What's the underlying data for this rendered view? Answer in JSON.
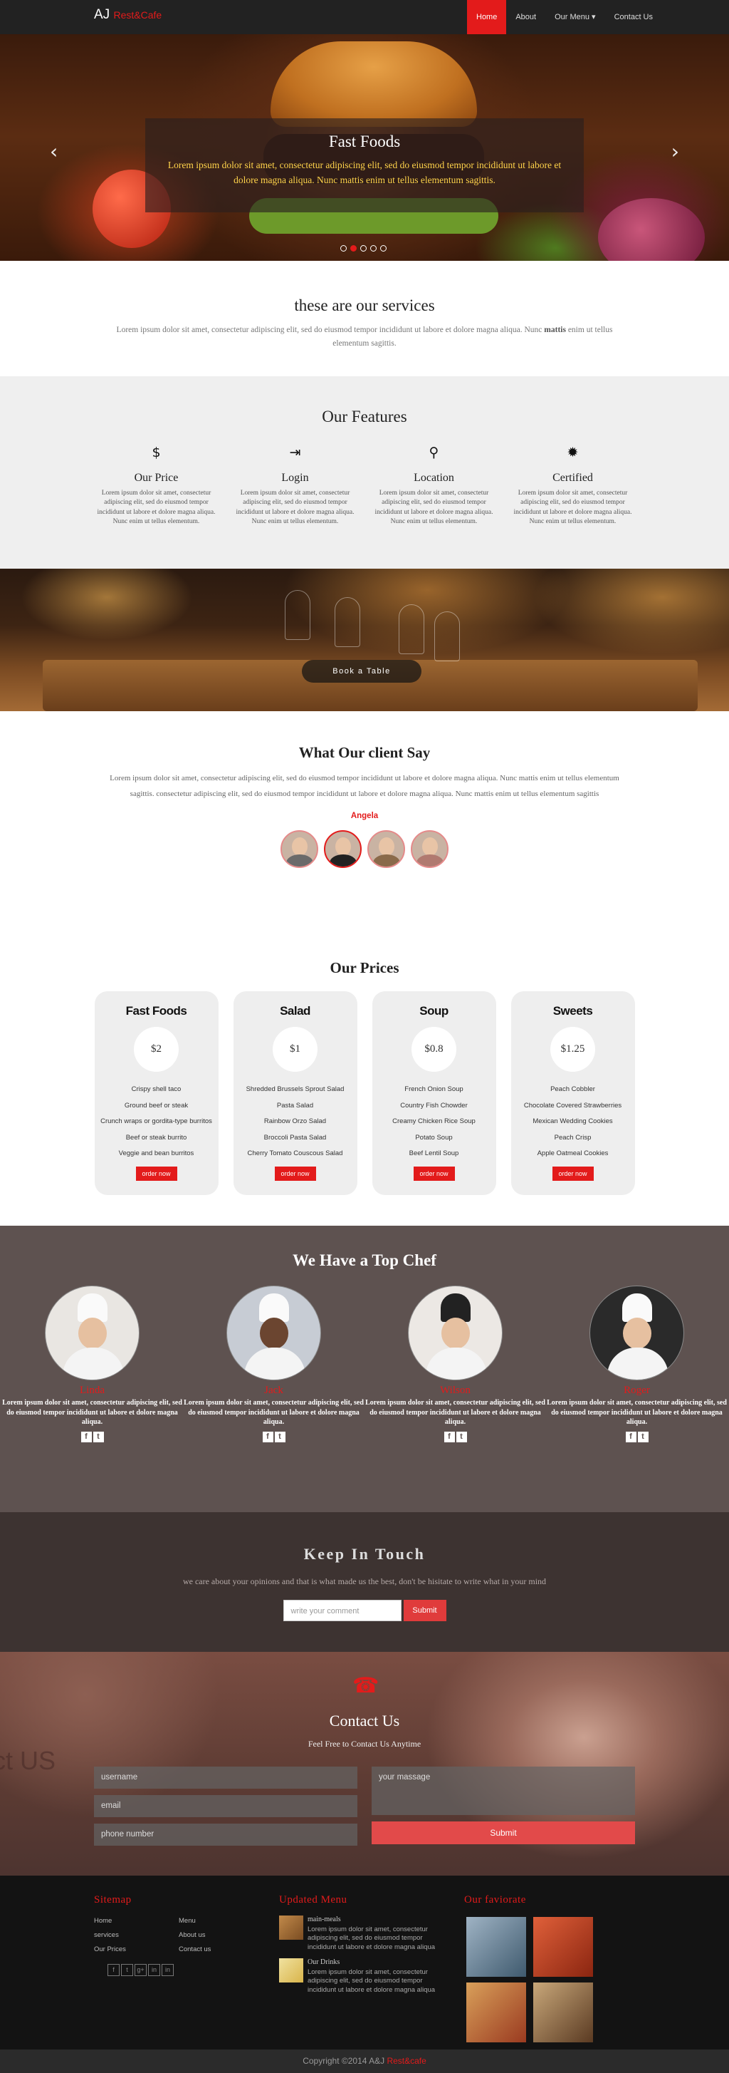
{
  "navbar": {
    "brand_main": "AJ",
    "brand_accent": "Rest&Cafe",
    "items": [
      {
        "label": "Home",
        "active": true
      },
      {
        "label": "About"
      },
      {
        "label": "Our Menu ▾"
      },
      {
        "label": "Contact Us"
      }
    ]
  },
  "hero": {
    "title": "Fast Foods",
    "text": "Lorem ipsum dolor sit amet, consectetur adipiscing elit, sed do eiusmod tempor incididunt ut labore et dolore magna aliqua. Nunc mattis enim ut tellus elementum sagittis.",
    "prev_icon": "chevron-left-icon",
    "next_icon": "chevron-right-icon",
    "slide_count": 5,
    "active_slide": 1
  },
  "services": {
    "title": "these are our services",
    "text": "Lorem ipsum dolor sit amet, consectetur adipiscing elit, sed do eiusmod tempor incididunt ut labore et dolore magna aliqua. Nunc",
    "bold": "mattis",
    "text2": "enim ut tellus elementum sagittis."
  },
  "features": {
    "title": "Our Features",
    "items": [
      {
        "icon": "dollar-icon",
        "glyph": "$",
        "title": "Our Price",
        "text": "Lorem ipsum dolor sit amet, consectetur adipiscing elit, sed do eiusmod tempor incididunt ut labore et dolore magna aliqua. Nunc enim ut tellus elementum."
      },
      {
        "icon": "login-icon",
        "glyph": "⇥",
        "title": "Login",
        "text": "Lorem ipsum dolor sit amet, consectetur adipiscing elit, sed do eiusmod tempor incididunt ut labore et dolore magna aliqua. Nunc enim ut tellus elementum."
      },
      {
        "icon": "map-marker-icon",
        "glyph": "⚲",
        "title": "Location",
        "text": "Lorem ipsum dolor sit amet, consectetur adipiscing elit, sed do eiusmod tempor incididunt ut labore et dolore magna aliqua. Nunc enim ut tellus elementum."
      },
      {
        "icon": "certificate-icon",
        "glyph": "✹",
        "title": "Certified",
        "text": "Lorem ipsum dolor sit amet, consectetur adipiscing elit, sed do eiusmod tempor incididunt ut labore et dolore magna aliqua. Nunc enim ut tellus elementum."
      }
    ]
  },
  "book": {
    "button": "Book a Table"
  },
  "client": {
    "title": "What Our client Say",
    "text": "Lorem ipsum dolor sit amet, consectetur adipiscing elit, sed do eiusmod tempor incididunt ut labore et dolore magna aliqua. Nunc mattis enim ut tellus elementum sagittis. consectetur adipiscing elit, sed do eiusmod tempor incididunt ut labore et dolore magna aliqua. Nunc mattis enim ut tellus elementum sagittis",
    "name": "Angela",
    "avatar_count": 4,
    "active_avatar": 1
  },
  "prices": {
    "title": "Our Prices",
    "order_label": "order now",
    "cards": [
      {
        "title": "Fast Foods",
        "price": "$2",
        "items": [
          "Crispy shell taco",
          "Ground beef or steak",
          "Crunch wraps or gordita-type burritos",
          "Beef or steak burrito",
          "Veggie and bean burritos"
        ]
      },
      {
        "title": "Salad",
        "price": "$1",
        "items": [
          "Shredded Brussels Sprout Salad",
          "Pasta Salad",
          "Rainbow Orzo Salad",
          "Broccoli Pasta Salad",
          "Cherry Tomato Couscous Salad"
        ]
      },
      {
        "title": "Soup",
        "price": "$0.8",
        "items": [
          "French Onion Soup",
          "Country Fish Chowder",
          "Creamy Chicken Rice Soup",
          "Potato Soup",
          "Beef Lentil Soup"
        ]
      },
      {
        "title": "Sweets",
        "price": "$1.25",
        "items": [
          "Peach Cobbler",
          "Chocolate Covered Strawberries",
          "Mexican Wedding Cookies",
          "Peach Crisp",
          "Apple Oatmeal Cookies"
        ]
      }
    ]
  },
  "chefs": {
    "title": "We Have a Top Chef",
    "items": [
      {
        "name": "Linda",
        "text": "Lorem ipsum dolor sit amet, consectetur adipiscing elit, sed do eiusmod tempor incididunt ut labore et dolore magna aliqua."
      },
      {
        "name": "Jack",
        "text": "Lorem ipsum dolor sit amet, consectetur adipiscing elit, sed do eiusmod tempor incididunt ut labore et dolore magna aliqua."
      },
      {
        "name": "Wilson",
        "text": "Lorem ipsum dolor sit amet, consectetur adipiscing elit, sed do eiusmod tempor incididunt ut labore et dolore magna aliqua."
      },
      {
        "name": "Roger",
        "text": "Lorem ipsum dolor sit amet, consectetur adipiscing elit, sed do eiusmod tempor incididunt ut labore et dolore magna aliqua."
      }
    ]
  },
  "touch": {
    "title": "Keep In Touch",
    "text": "we care about your opinions and that is what made us the best, don't be hisitate to write what in your mind",
    "placeholder": "write your comment",
    "submit": "Submit"
  },
  "contact": {
    "bg_text": "ct US",
    "title": "Contact Us",
    "subtitle": "Feel Free to Contact Us Anytime",
    "username": "username",
    "email": "email",
    "phone": "phone number",
    "message": "your massage",
    "submit": "Submit"
  },
  "footer": {
    "sitemap_title": "Sitemap",
    "sitemap_col1": [
      "Home",
      "services",
      "Our Prices"
    ],
    "sitemap_col2": [
      "Menu",
      "About us",
      "Contact us"
    ],
    "social": [
      "f",
      "t",
      "g+",
      "in",
      "in"
    ],
    "menu_title": "Updated Menu",
    "menu_items": [
      {
        "title": "main-meals",
        "text": "Lorem ipsum dolor sit amet, consectetur adipiscing elit, sed do eiusmod tempor incididunt ut labore et dolore magna aliqua"
      },
      {
        "title": "Our Drinks",
        "text": "Lorem ipsum dolor sit amet, consectetur adipiscing elit, sed do eiusmod tempor incididunt ut labore et dolore magna aliqua"
      }
    ],
    "favorite_title": "Our faviorate",
    "copyright": "Copyright ©2014 A&J",
    "copyright_accent": "Rest&cafe"
  }
}
